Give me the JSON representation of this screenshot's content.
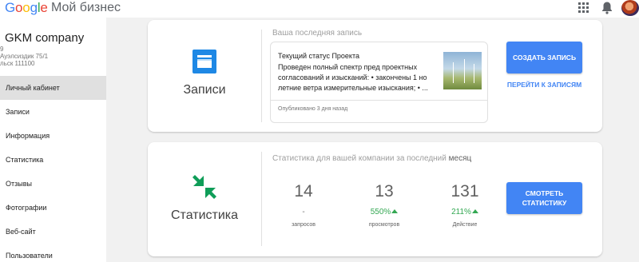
{
  "header": {
    "logo_letters": [
      "G",
      "o",
      "o",
      "g",
      "l",
      "e"
    ],
    "logo_colors": [
      "#4285f4",
      "#ea4335",
      "#fbbc05",
      "#4285f4",
      "#34a853",
      "#ea4335"
    ],
    "product": "Мой бизнес",
    "apps_icon": "apps-grid-icon",
    "notifications_icon": "bell-icon"
  },
  "sidebar": {
    "company": "GKM company",
    "address_lines": [
      "9",
      "Ауэлсиздик 75/1",
      "льск 111100"
    ],
    "items": [
      {
        "label": "Личный кабинет",
        "active": true
      },
      {
        "label": "Записи"
      },
      {
        "label": "Информация"
      },
      {
        "label": "Статистика"
      },
      {
        "label": "Отзывы"
      },
      {
        "label": "Фотографии"
      },
      {
        "label": "Веб-сайт"
      },
      {
        "label": "Пользователи"
      }
    ]
  },
  "posts_card": {
    "icon": "posts-icon",
    "label": "Записи",
    "section_title": "Ваша последняя запись",
    "post": {
      "title": "Текущий статус Проекта",
      "body": "Проведен полный спектр пред проектных согласований и изысканий: • закончены 1 но летние ветра измерительные изыскания; • ...",
      "thumbnail": "wind-turbines-photo",
      "date": "Опубликовано 3 дня назад"
    },
    "primary_button": "СОЗДАТЬ ЗАПИСЬ",
    "link_button": "ПЕРЕЙТИ К ЗАПИСЯМ"
  },
  "stats_card": {
    "icon": "stats-arrows-icon",
    "label": "Статистика",
    "section_title": "Статистика для вашей компании за последний",
    "section_title_period": "месяц",
    "stats": [
      {
        "value": "14",
        "change": "-",
        "trend": "flat",
        "label": "запросов"
      },
      {
        "value": "13",
        "change": "550%",
        "trend": "up",
        "label": "просмотров"
      },
      {
        "value": "131",
        "change": "211%",
        "trend": "up",
        "label": "Действие"
      }
    ],
    "primary_button": "СМОТРЕТЬ СТАТИСТИКУ"
  },
  "colors": {
    "accent": "#4285f4",
    "positive": "#34a853",
    "stats_icon": "#0f9d58"
  }
}
